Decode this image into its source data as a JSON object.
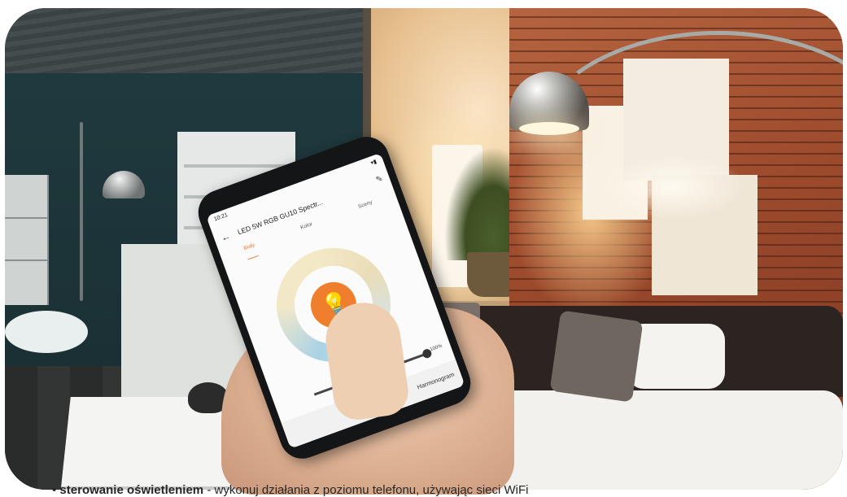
{
  "photo": {
    "description_alt": "Hand holding smartphone with smart lighting app in a living room"
  },
  "phone": {
    "status_time": "10:21",
    "signal": "▾▮",
    "back_icon": "arrow-left-icon",
    "title": "LED 5W RGB GU10 Spectr...",
    "edit_icon": "pencil-icon",
    "tabs": [
      {
        "label": "Biały",
        "active": true
      },
      {
        "label": "Kolor",
        "active": false
      },
      {
        "label": "Sceny",
        "active": false
      }
    ],
    "bulb_icon": "lightbulb-icon",
    "brightness": "100%",
    "schedule_label": "Harmonogram"
  },
  "caption": {
    "bold": "sterowanie oświetleniem",
    "text": " - wykonuj działania z poziomu telefonu, używając sieci WiFi"
  },
  "colors": {
    "accent": "#f07f2d",
    "ring_cool": "#a9d2e6",
    "ring_warm": "#f4e9c7"
  }
}
